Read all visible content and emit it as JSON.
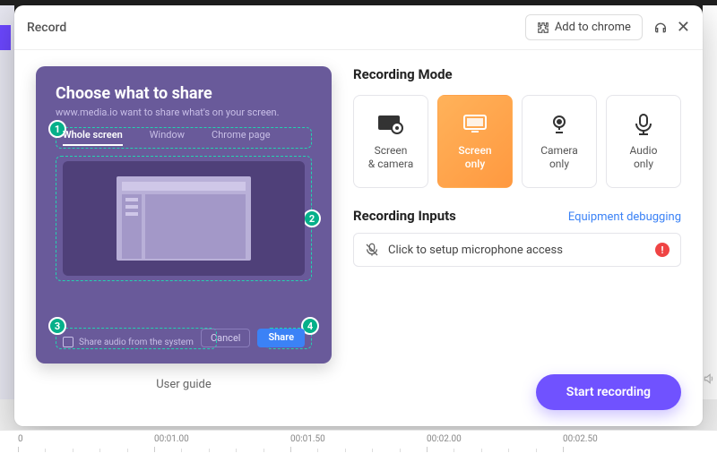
{
  "header": {
    "title": "Record",
    "add_to_chrome": "Add to chrome"
  },
  "guide": {
    "share_title": "Choose what to share",
    "share_subtitle": "www.media.io want to share what's on your screen.",
    "tabs": {
      "whole": "Whole screen",
      "window": "Window",
      "chrome": "Chrome page"
    },
    "audio_label": "Share audio from the system",
    "cancel": "Cancel",
    "share": "Share",
    "badges": {
      "b1": "1",
      "b2": "2",
      "b3": "3",
      "b4": "4"
    },
    "caption": "User guide"
  },
  "right": {
    "mode_title": "Recording Mode",
    "modes": {
      "screen_camera": "Screen\n& camera",
      "screen_only": "Screen\nonly",
      "camera_only": "Camera\nonly",
      "audio_only": "Audio\nonly"
    },
    "inputs_title": "Recording Inputs",
    "equipment_link": "Equipment debugging",
    "mic_setup": "Click to setup microphone access",
    "warn": "!"
  },
  "cta": {
    "start": "Start recording"
  },
  "timeline": {
    "t0": "0",
    "t1": "00:01.00",
    "t2": "00:01.50",
    "t3": "00:02.00",
    "t4": "00:02.50"
  }
}
